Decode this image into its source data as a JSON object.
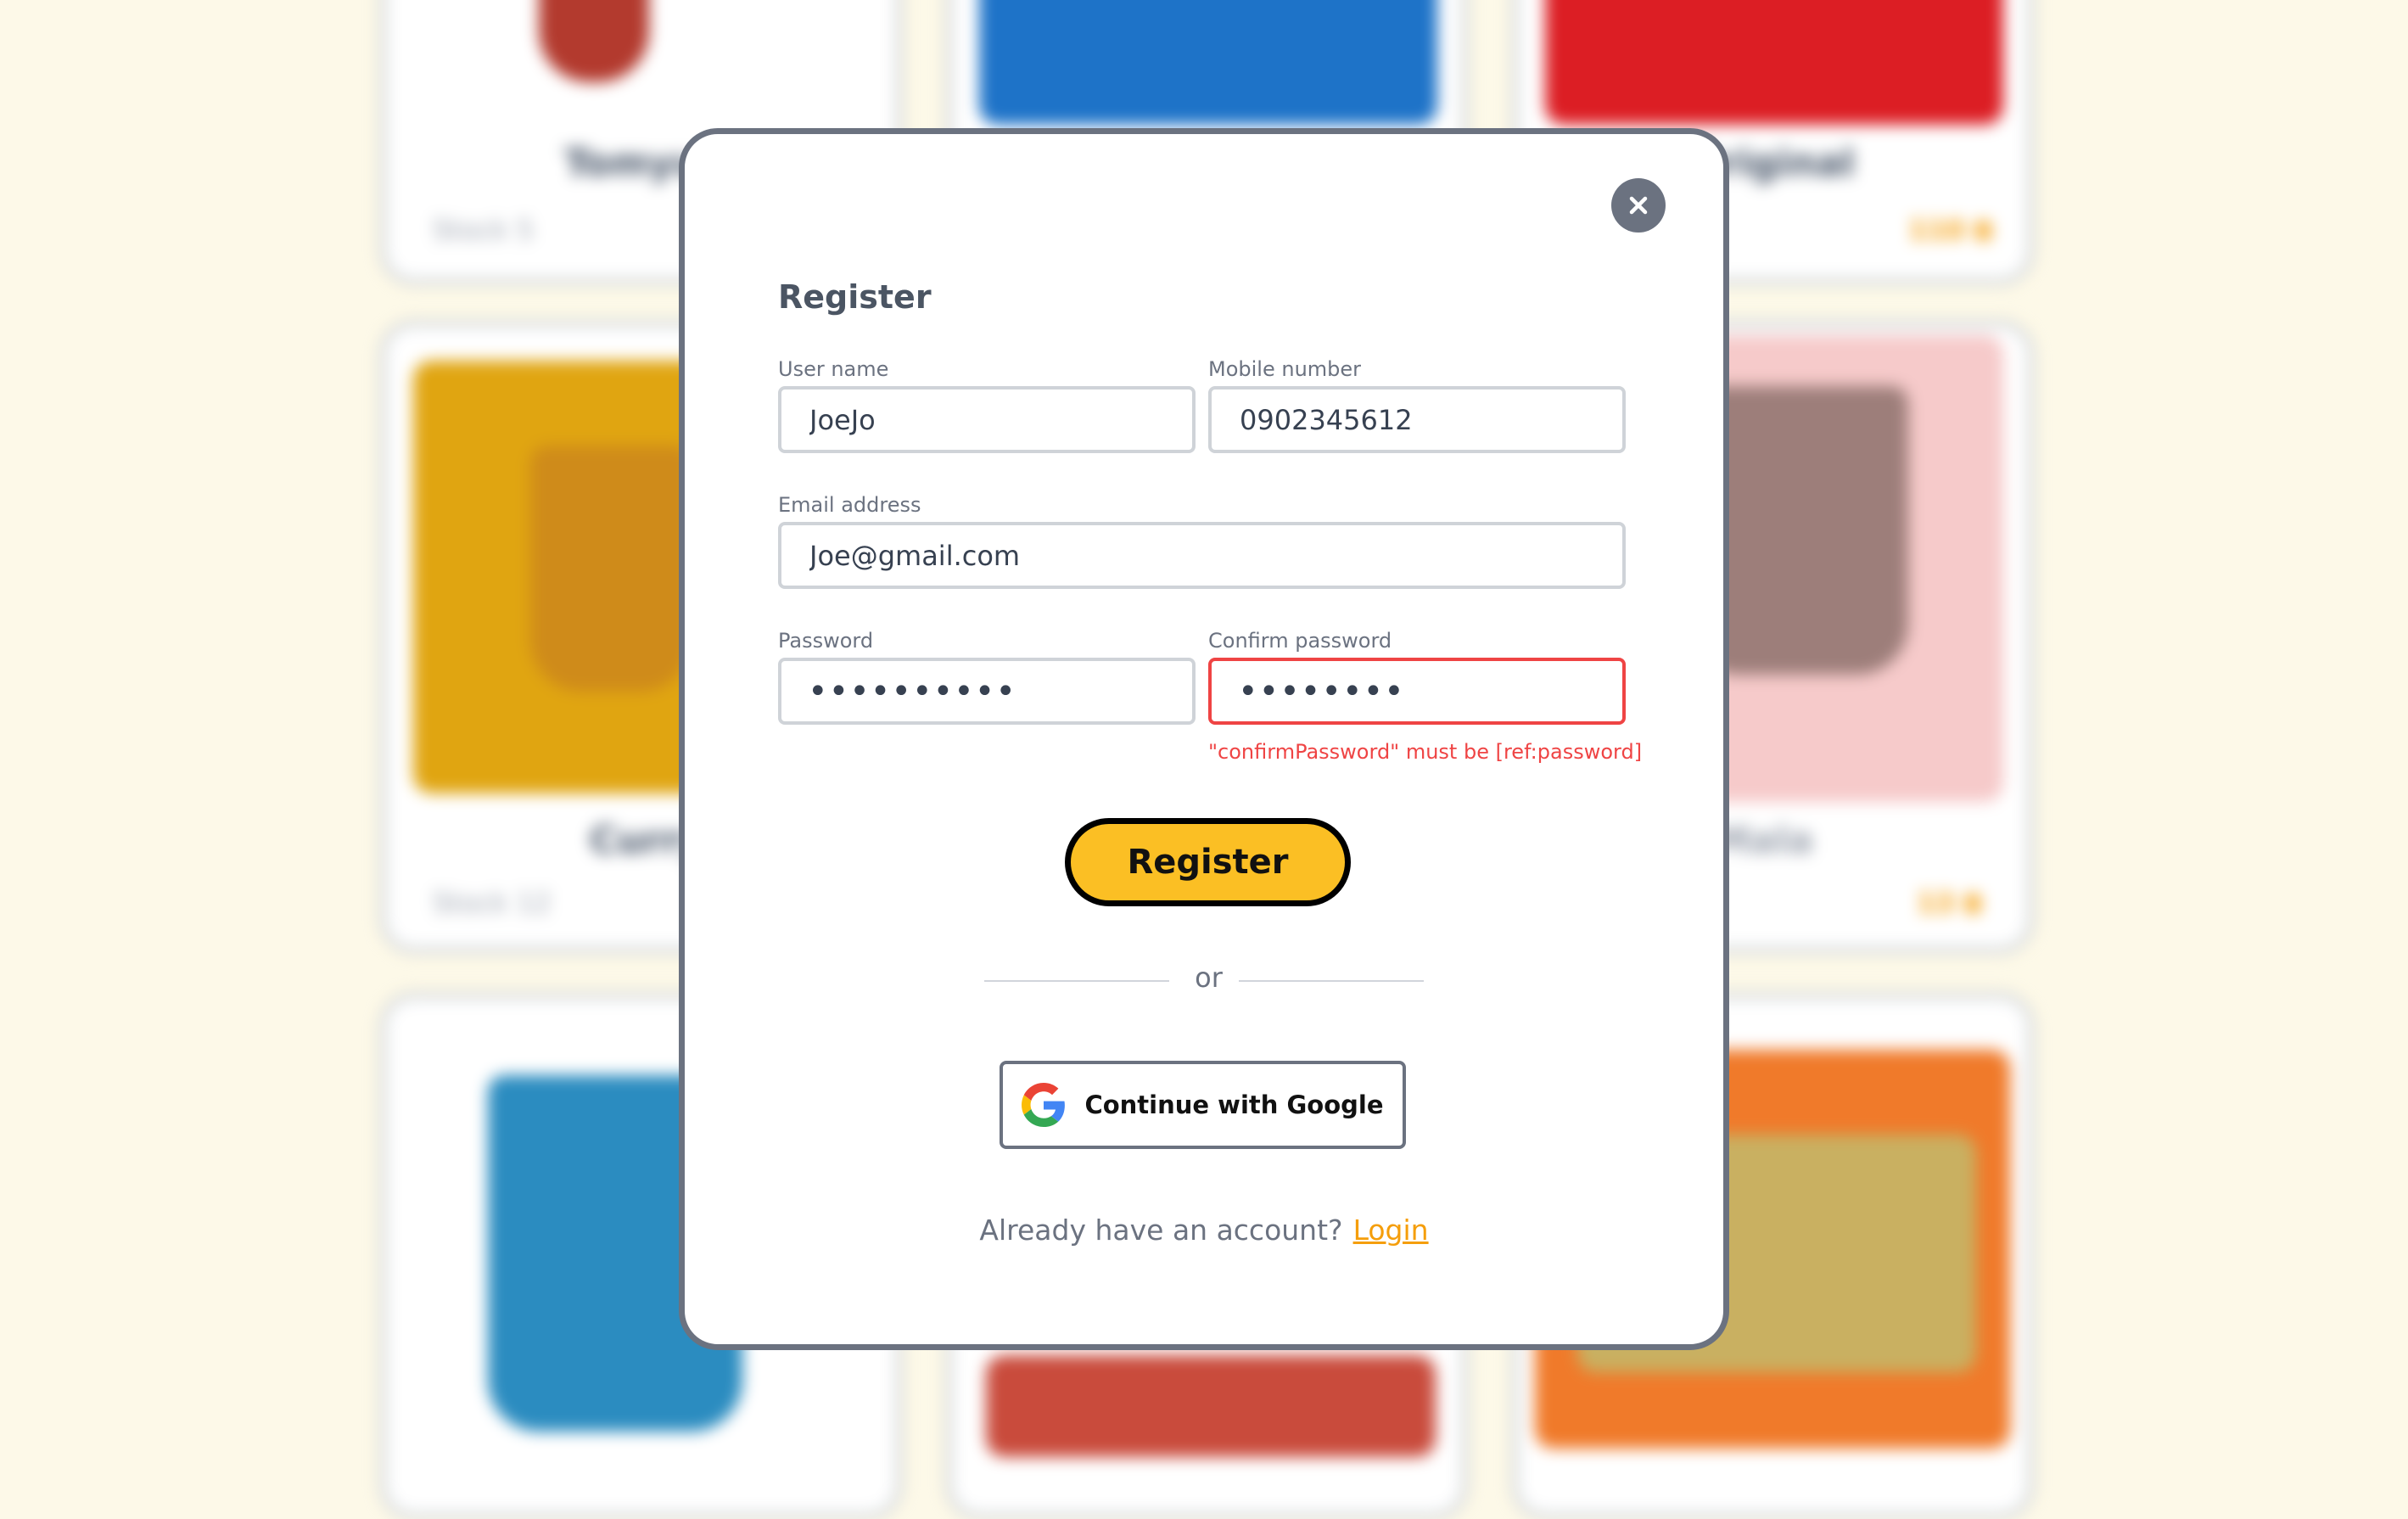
{
  "background_cards": [
    {
      "name": "Tomyum",
      "stock": "Stock 5",
      "price": ""
    },
    {
      "name": "",
      "stock": "",
      "price": ""
    },
    {
      "name": "Original",
      "stock": "",
      "price": "110 ฿"
    },
    {
      "name": "Curry",
      "stock": "Stock 12",
      "price": ""
    },
    {
      "name": "",
      "stock": "",
      "price": ""
    },
    {
      "name": "Mala",
      "stock": "",
      "price": "13 ฿"
    }
  ],
  "modal": {
    "title": "Register",
    "fields": {
      "username": {
        "label": "User name",
        "value": "JoeJo"
      },
      "mobile": {
        "label": "Mobile number",
        "value": "0902345612"
      },
      "email": {
        "label": "Email address",
        "value": "Joe@gmail.com"
      },
      "password": {
        "label": "Password",
        "value": "••••••••••"
      },
      "confirm": {
        "label": "Confirm password",
        "value": "••••••••",
        "error": "\"confirmPassword\" must be [ref:password]"
      }
    },
    "register_label": "Register",
    "divider_text": "or",
    "google_label": "Continue with Google",
    "footer_text": "Already have an account?",
    "login_label": "Login"
  },
  "colors": {
    "accent": "#fbbf24",
    "error": "#ef4444",
    "link": "#f59e0b",
    "page_background": "#fdf9e8"
  },
  "icons": {
    "close": "close-icon",
    "google": "google-icon"
  }
}
